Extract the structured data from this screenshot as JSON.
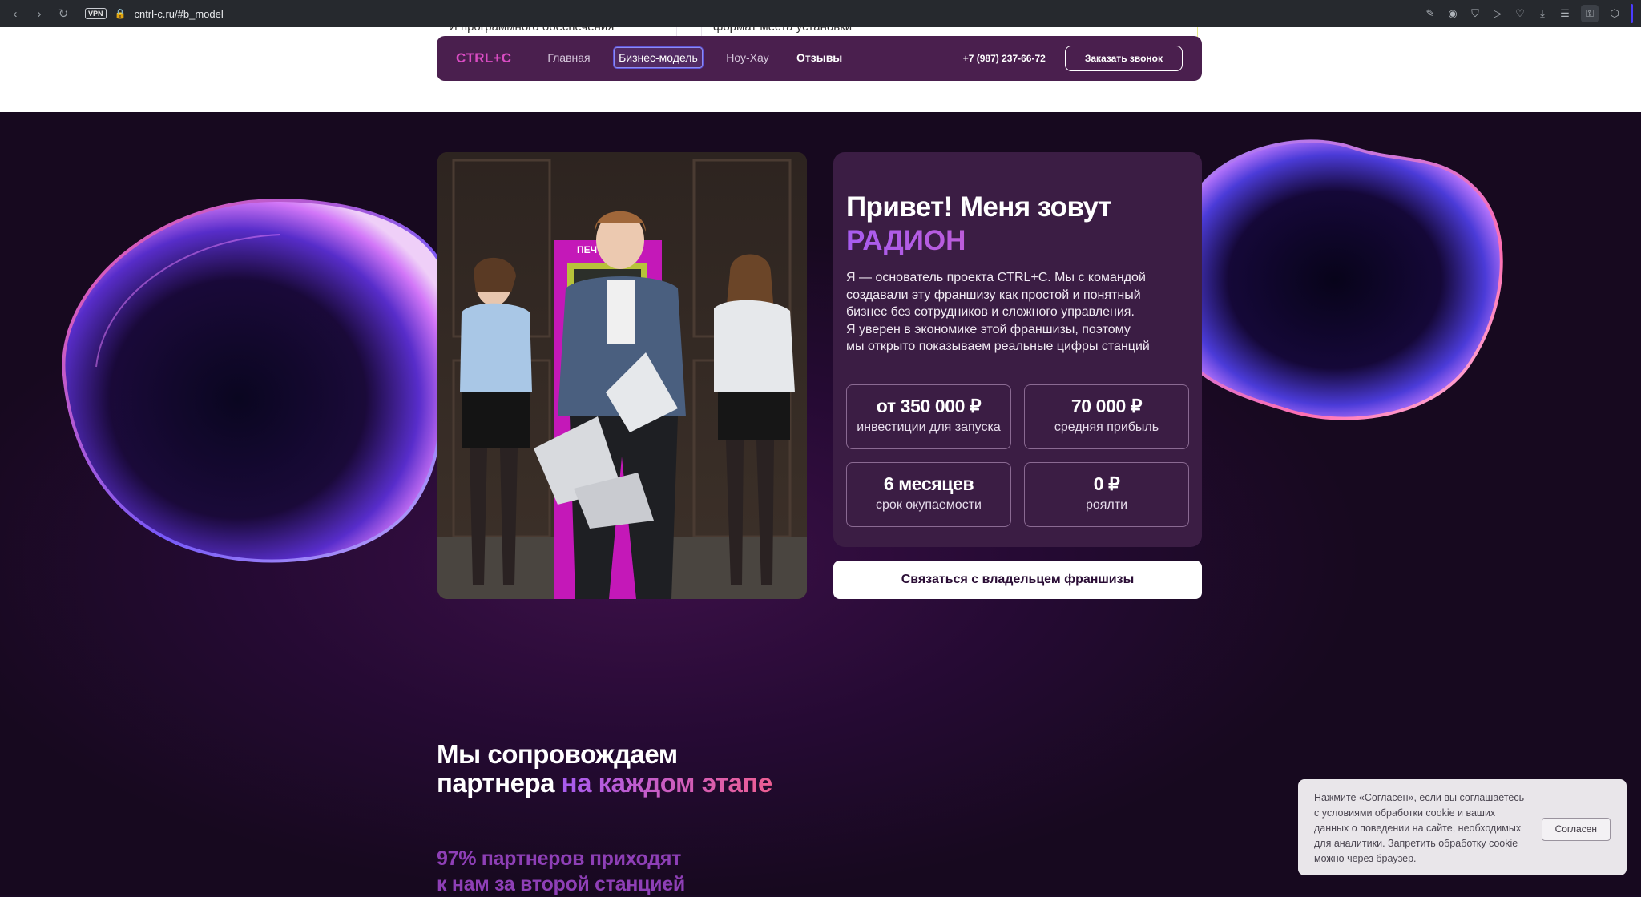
{
  "browser": {
    "url": "cntrl-c.ru/#b_model",
    "vpn_label": "VPN"
  },
  "prev_section": {
    "card1": "И программного обеспечения",
    "card2": "формат места установки",
    "card3": ""
  },
  "header": {
    "logo": "CTRL+C",
    "nav": [
      "Главная",
      "Бизнес-модель",
      "Ноу-Хау",
      "Отзывы"
    ],
    "phone": "+7 (987) 237-66-72",
    "call_button": "Заказать звонок"
  },
  "hero": {
    "greeting": "Привет! Меня зовут",
    "name": "РАДИОН",
    "description_lines": [
      "Я — основатель проекта CTRL+C. Мы с командой",
      "создавали эту франшизу как простой и понятный",
      "бизнес без сотрудников и сложного управления.",
      "Я уверен в экономике этой франшизы, поэтому",
      "мы открыто показываем реальные цифры станций"
    ],
    "stats": [
      {
        "value": "от 350 000 ₽",
        "label": "инвестиции для запуска"
      },
      {
        "value": "70 000 ₽",
        "label": "средняя прибыль"
      },
      {
        "value": "6 месяцев",
        "label": "срок окупаемости"
      },
      {
        "value": "0 ₽",
        "label": "роялти"
      }
    ],
    "contact_button": "Связаться с владельцем франшизы",
    "kiosk_label": "ПЕЧ"
  },
  "support": {
    "title_line1": "Мы сопровождаем",
    "title_line2_plain": "партнера ",
    "title_line2_grad": "на каждом этапе",
    "percent_line1": "97% партнеров приходят",
    "percent_line2": "к нам за второй станцией"
  },
  "cookie": {
    "text": "Нажмите «Согласен», если вы соглашаетесь с условиями обработки cookie и ваших данных о поведении на сайте, необходимых для аналитики. Запретить обработку cookie можно через браузер.",
    "agree_button": "Согласен"
  },
  "colors": {
    "accent_pink": "#d94cc2",
    "accent_violet": "#a75cf0",
    "bg_dark": "#1a0a24",
    "card_bg": "#3b1d44"
  }
}
